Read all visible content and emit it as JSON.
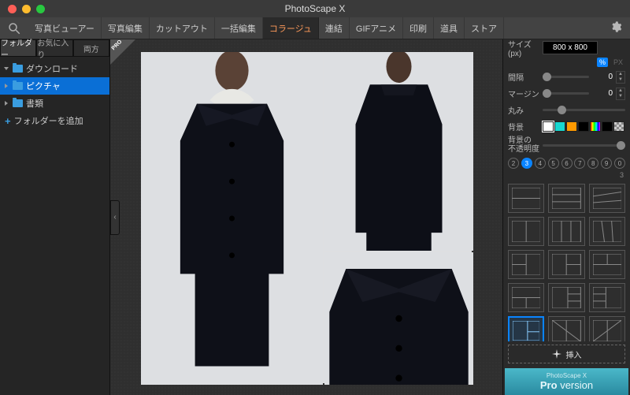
{
  "title": "PhotoScape X",
  "menu": [
    "写真ビューアー",
    "写真編集",
    "カットアウト",
    "一括編集",
    "コラージュ",
    "連結",
    "GIFアニメ",
    "印刷",
    "道具",
    "ストア"
  ],
  "menu_active": 4,
  "sidebar": {
    "tabs": [
      "フォルダー",
      "お気に入り",
      "両方"
    ],
    "tabs_active": 0,
    "items": [
      {
        "label": "ダウンロード",
        "sel": false,
        "expand": true
      },
      {
        "label": "ピクチャ",
        "sel": true,
        "expand": false
      },
      {
        "label": "書類",
        "sel": false,
        "expand": false
      }
    ],
    "add_folder": "フォルダーを追加"
  },
  "pro_badge": "PRO",
  "panel": {
    "size_label": "サイズ (px)",
    "size_value": "800 x 800",
    "pct": "%",
    "px": "PX",
    "spacing_label": "間隔",
    "spacing_value": "0",
    "margin_label": "マージン",
    "margin_value": "0",
    "round_label": "丸み",
    "bg_label": "背景",
    "bgopacity_label": "背景の\n不透明度",
    "swatch_colors": [
      "#ffffff",
      "#17d7d1",
      "#ff9a00",
      "#000000"
    ],
    "swatch_grad": true,
    "swatch_checker": true,
    "counts": [
      "2",
      "3",
      "4",
      "5",
      "6",
      "7",
      "8",
      "9",
      "0"
    ],
    "counts_sel": 1,
    "template_count": "3",
    "insert_label": "挿入",
    "pro_line1": "PhotoScape X",
    "pro_line2a": "Pro ",
    "pro_line2b": "version",
    "templates_selected": 12
  }
}
